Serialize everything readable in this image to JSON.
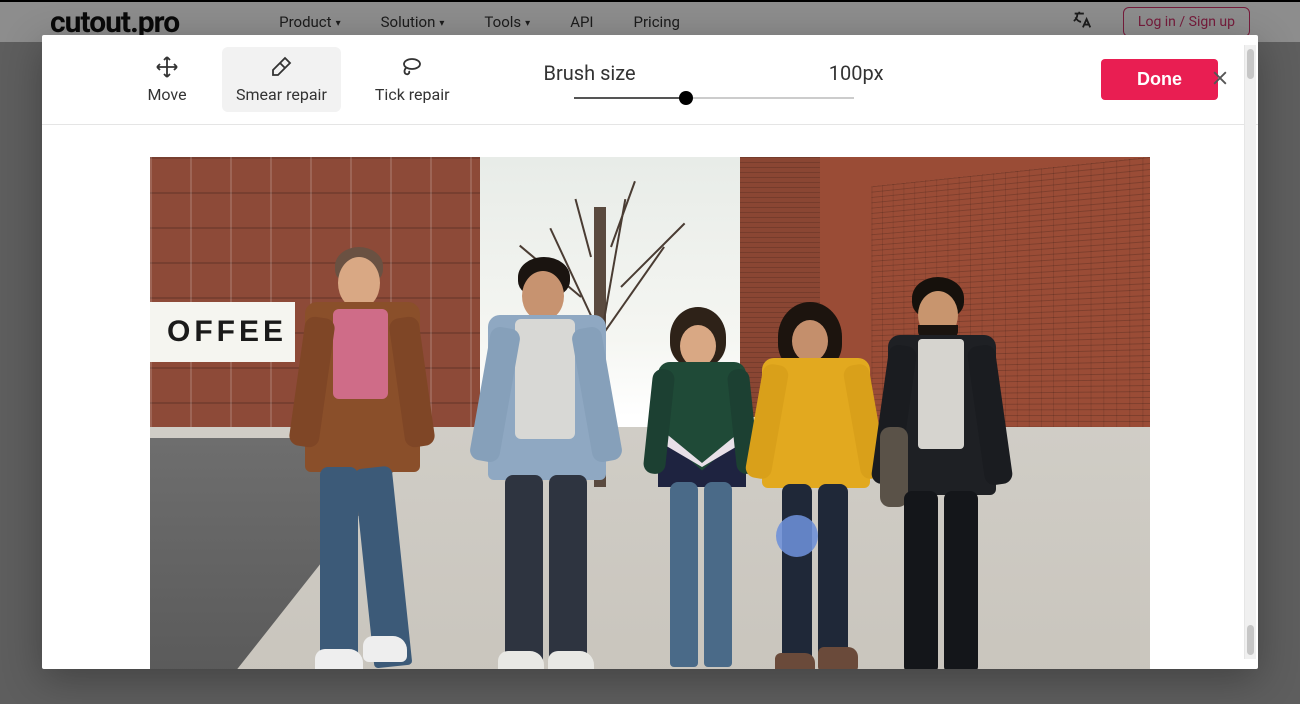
{
  "background": {
    "logo": "cutout.pro",
    "nav": {
      "product": "Product",
      "solution": "Solution",
      "tools": "Tools",
      "api": "API",
      "pricing": "Pricing"
    },
    "login": "Log in / Sign up"
  },
  "toolbar": {
    "move": "Move",
    "smear_repair": "Smear repair",
    "tick_repair": "Tick repair",
    "brush_label": "Brush size",
    "brush_value": "100px",
    "done": "Done"
  },
  "canvas": {
    "coffee_sign": "OFFEE",
    "brush_cursor_size_px": 42
  },
  "colors": {
    "primary": "#e91e52",
    "brush": "#6d8fd8"
  },
  "icons": {
    "move": "move-icon",
    "eraser": "eraser-icon",
    "lasso": "lasso-icon",
    "close": "close-icon",
    "language": "language-icon"
  }
}
